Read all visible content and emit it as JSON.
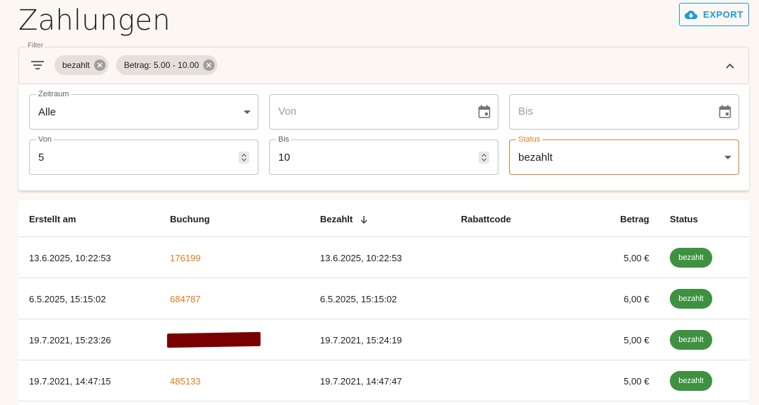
{
  "header": {
    "title": "Zahlungen",
    "export_label": "EXPORT",
    "export_icon": "cloud-download-icon",
    "accent_color": "#1e9bd7"
  },
  "filter": {
    "legend": "Filter",
    "chips": [
      {
        "label": "bezahlt"
      },
      {
        "label": "Betrag: 5.00 - 10.00"
      }
    ]
  },
  "filter_panel": {
    "zeitraum": {
      "label": "Zeitraum",
      "value": "Alle"
    },
    "date_from": {
      "placeholder": "Von"
    },
    "date_to": {
      "placeholder": "Bis"
    },
    "amount_from": {
      "label": "Von",
      "value": "5"
    },
    "amount_to": {
      "label": "Bis",
      "value": "10"
    },
    "status": {
      "label": "Status",
      "value": "bezahlt"
    }
  },
  "table": {
    "columns": [
      "Erstellt am",
      "Buchung",
      "Bezahlt",
      "Rabattcode",
      "Betrag",
      "Status"
    ],
    "rows": [
      {
        "created": "13.6.2025, 10:22:53",
        "booking": "176199",
        "paid": "13.6.2025, 10:22:53",
        "discount": "",
        "amount": "5,00 €",
        "status": "bezahlt"
      },
      {
        "created": "6.5.2025, 15:15:02",
        "booking": "684787",
        "paid": "6.5.2025, 15:15:02",
        "discount": "",
        "amount": "6,00 €",
        "status": "bezahlt"
      },
      {
        "created": "19.7.2021, 15:23:26",
        "booking": "",
        "paid": "19.7.2021, 15:24:19",
        "discount": "",
        "amount": "5,00 €",
        "status": "bezahlt"
      },
      {
        "created": "19.7.2021, 14:47:15",
        "booking": "485133",
        "paid": "19.7.2021, 14:47:47",
        "discount": "",
        "amount": "5,00 €",
        "status": "bezahlt"
      }
    ]
  },
  "colors": {
    "link": "#e07b1f",
    "status_paid": "#3f9142",
    "focus": "#d9822b",
    "redaction": "#7a0000"
  }
}
